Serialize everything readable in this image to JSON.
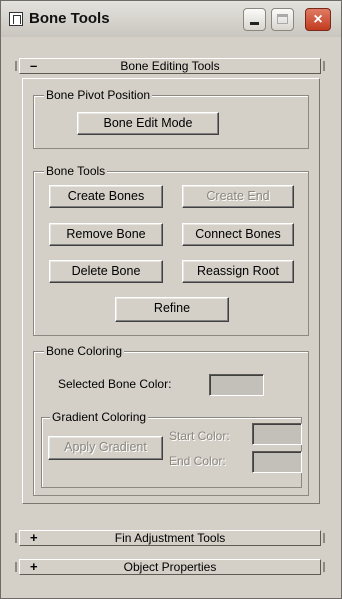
{
  "window": {
    "title": "Bone Tools",
    "close_glyph": "×"
  },
  "rollouts": [
    {
      "sign": "–",
      "label": "Bone Editing Tools"
    },
    {
      "sign": "+",
      "label": "Fin Adjustment Tools"
    },
    {
      "sign": "+",
      "label": "Object Properties"
    }
  ],
  "bone_pivot": {
    "group_label": "Bone Pivot Position",
    "edit_mode_label": "Bone Edit Mode"
  },
  "bone_tools": {
    "group_label": "Bone Tools",
    "create_bones": "Create Bones",
    "create_end": "Create End",
    "remove_bone": "Remove Bone",
    "connect_bones": "Connect Bones",
    "delete_bone": "Delete Bone",
    "reassign_root": "Reassign Root",
    "refine": "Refine"
  },
  "bone_coloring": {
    "group_label": "Bone Coloring",
    "selected_color_label": "Selected Bone Color:",
    "gradient": {
      "group_label": "Gradient Coloring",
      "apply_label": "Apply Gradient",
      "start_label": "Start Color:",
      "end_label": "End Color:"
    }
  },
  "icons": [
    "app-icon",
    "minimize-icon",
    "maximize-icon",
    "close-icon"
  ],
  "colors": {
    "face": "#d4d0c8",
    "close_red": "#c13b1f",
    "swatch": "#c3c0b9"
  }
}
